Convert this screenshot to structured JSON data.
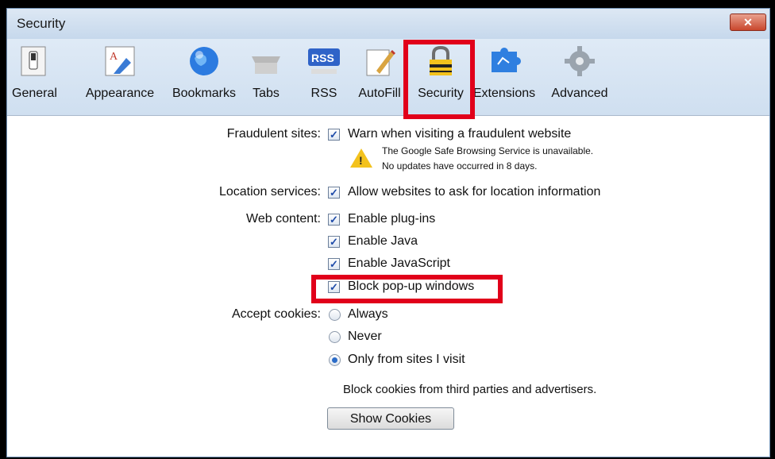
{
  "window": {
    "title": "Security",
    "close_icon": "close-icon"
  },
  "toolbar": {
    "items": [
      {
        "label": "General",
        "icon": "general-switch-icon"
      },
      {
        "label": "Appearance",
        "icon": "appearance-icon"
      },
      {
        "label": "Bookmarks",
        "icon": "bookmarks-globe-icon"
      },
      {
        "label": "Tabs",
        "icon": "tabs-icon"
      },
      {
        "label": "RSS",
        "icon": "rss-icon"
      },
      {
        "label": "AutoFill",
        "icon": "autofill-pen-icon"
      },
      {
        "label": "Security",
        "icon": "lock-icon"
      },
      {
        "label": "Extensions",
        "icon": "extensions-puzzle-icon"
      },
      {
        "label": "Advanced",
        "icon": "gear-icon"
      }
    ],
    "selected": "Security"
  },
  "security": {
    "fraudulent": {
      "label": "Fraudulent sites:",
      "option": "Warn when visiting a fraudulent website",
      "checked": true,
      "warning_line1": "The Google Safe Browsing Service is unavailable.",
      "warning_line2": "No updates have occurred in 8 days."
    },
    "location": {
      "label": "Location services:",
      "option": "Allow websites to ask for location information",
      "checked": true
    },
    "web_content": {
      "label": "Web content:",
      "options": [
        {
          "label": "Enable plug-ins",
          "checked": true
        },
        {
          "label": "Enable Java",
          "checked": true
        },
        {
          "label": "Enable JavaScript",
          "checked": true
        },
        {
          "label": "Block pop-up windows",
          "checked": true
        }
      ]
    },
    "cookies": {
      "label": "Accept cookies:",
      "options": [
        {
          "label": "Always",
          "selected": false
        },
        {
          "label": "Never",
          "selected": false
        },
        {
          "label": "Only from sites I visit",
          "selected": true
        }
      ],
      "note": "Block cookies from third parties and advertisers.",
      "button": "Show Cookies"
    }
  },
  "colors": {
    "highlight": "#e1001a",
    "checkmark": "#1d4aa8",
    "warning": "#f3c21d"
  }
}
